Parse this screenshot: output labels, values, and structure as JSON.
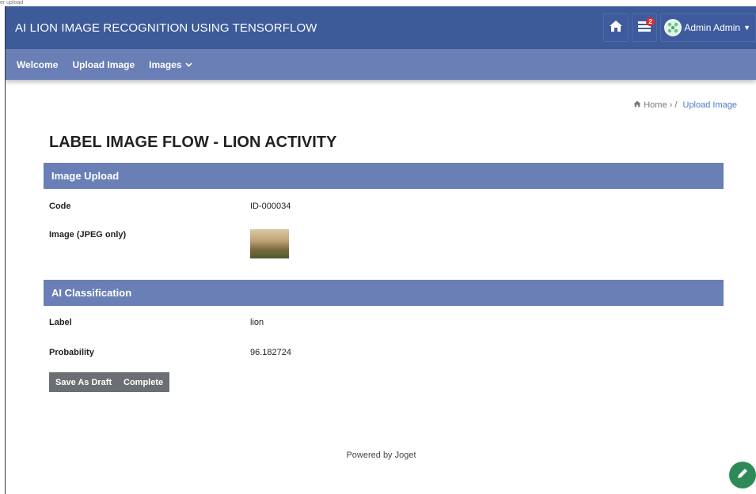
{
  "browser": {
    "tab_text": "er upload"
  },
  "header": {
    "app_title": "AI LION IMAGE RECOGNITION USING TENSORFLOW",
    "home_icon": "home-icon",
    "notifications_icon": "inbox-icon",
    "notifications_count": "2",
    "user_name": "Admin Admin"
  },
  "nav": {
    "items": [
      {
        "label": "Welcome"
      },
      {
        "label": "Upload Image"
      },
      {
        "label": "Images"
      }
    ]
  },
  "breadcrumb": {
    "home": "Home",
    "separator": "›",
    "slash": "/",
    "current": "Upload Image"
  },
  "page": {
    "title": "LABEL IMAGE FLOW - LION ACTIVITY"
  },
  "image_upload": {
    "section_title": "Image Upload",
    "code_label": "Code",
    "code_value": "ID-000034",
    "image_label": "Image (JPEG only)"
  },
  "classification": {
    "section_title": "AI Classification",
    "label_label": "Label",
    "label_value": "lion",
    "probability_label": "Probability",
    "probability_value": "96.182724"
  },
  "actions": {
    "save_draft": "Save As Draft",
    "complete": "Complete"
  },
  "footer": {
    "text": "Powered by Joget"
  },
  "colors": {
    "header": "#3d5a99",
    "nav": "#6a7fb6",
    "section": "#6a7fb6",
    "button": "#6b6f73",
    "fab": "#2e8b57"
  }
}
